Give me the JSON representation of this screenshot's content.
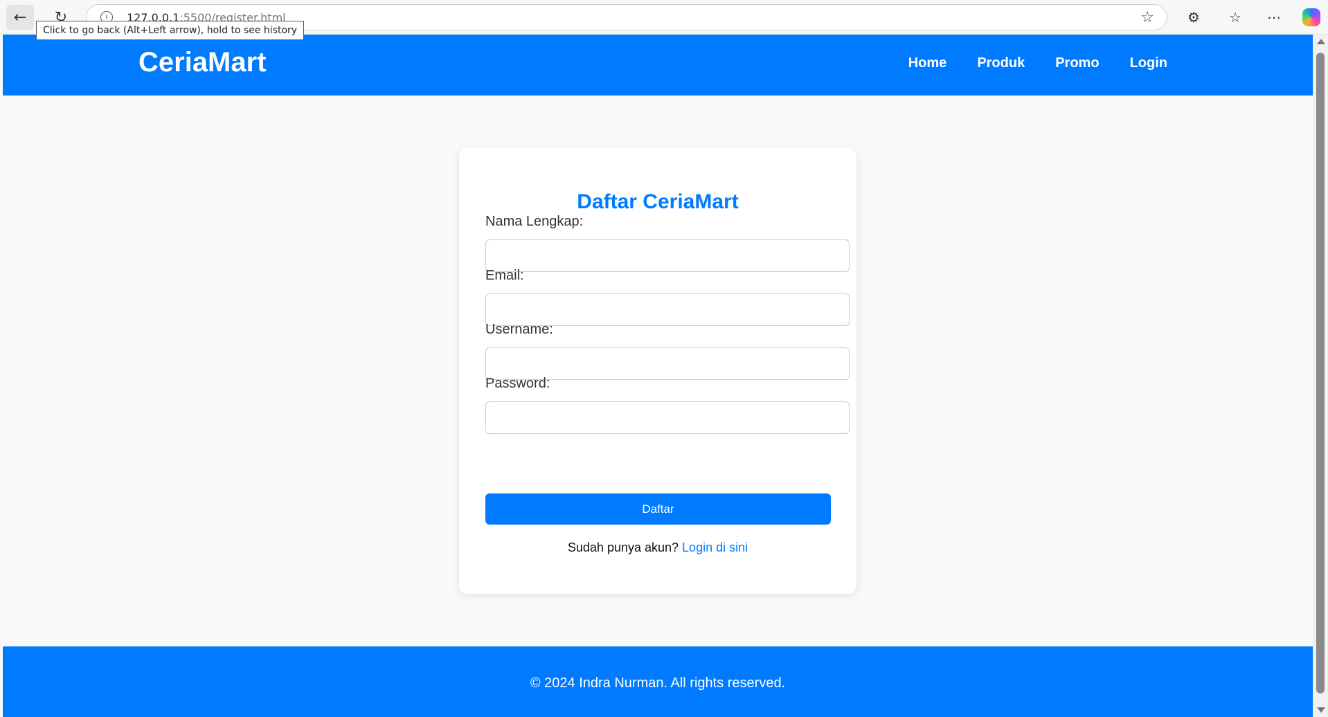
{
  "browser": {
    "url_host": "127.0.0.1",
    "url_rest": ":5500/register.html",
    "tooltip": "Click to go back (Alt+Left arrow), hold to see history",
    "icons": [
      "back-arrow-icon",
      "reload-icon",
      "info-icon",
      "star-icon",
      "extensions-icon",
      "favorites-icon",
      "more-icon",
      "copilot-icon"
    ]
  },
  "header": {
    "logo": "CeriaMart",
    "nav": [
      "Home",
      "Produk",
      "Promo",
      "Login"
    ]
  },
  "form": {
    "title": "Daftar CeriaMart",
    "fields": [
      {
        "label": "Nama Lengkap:",
        "value": ""
      },
      {
        "label": "Email:",
        "value": ""
      },
      {
        "label": "Username:",
        "value": ""
      },
      {
        "label": "Password:",
        "value": ""
      }
    ],
    "submit_label": "Daftar",
    "login_prompt": "Sudah punya akun?",
    "login_link": "Login di sini"
  },
  "footer": {
    "text": "© 2024 Indra Nurman. All rights reserved."
  },
  "colors": {
    "primary": "#007bff",
    "background": "#f9f9f9",
    "card": "#ffffff"
  }
}
